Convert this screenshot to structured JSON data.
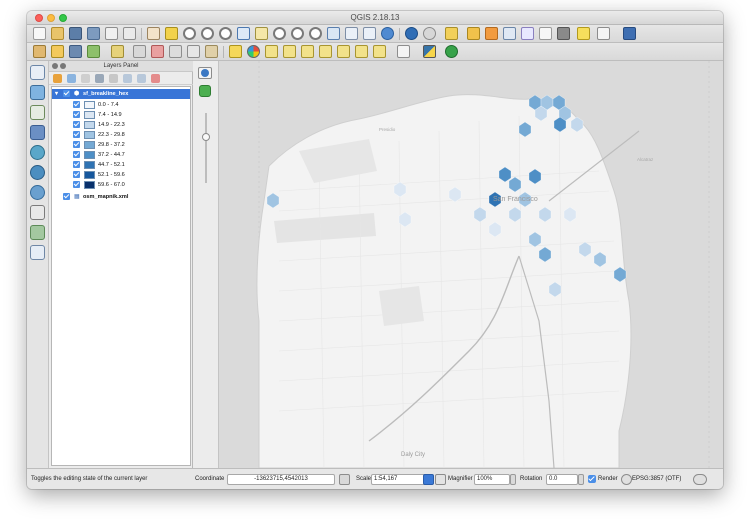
{
  "window": {
    "title": "QGIS 2.18.13"
  },
  "layers_panel": {
    "title": "Layers Panel",
    "layers": [
      {
        "name": "sf_breakline_hex",
        "checked": true,
        "selected": true,
        "legend": [
          {
            "label": "0.0 - 7.4",
            "color": "#f2f6fb"
          },
          {
            "label": "7.4 - 14.9",
            "color": "#dce7f3"
          },
          {
            "label": "14.9 - 22.3",
            "color": "#c3d8ec"
          },
          {
            "label": "22.3 - 29.8",
            "color": "#a0c4e2"
          },
          {
            "label": "29.8 - 37.2",
            "color": "#74a9d4"
          },
          {
            "label": "37.2 - 44.7",
            "color": "#4e8fc6"
          },
          {
            "label": "44.7 - 52.1",
            "color": "#2f73b3"
          },
          {
            "label": "52.1 - 59.6",
            "color": "#16579d"
          },
          {
            "label": "59.6 - 67.0",
            "color": "#08306b"
          }
        ]
      },
      {
        "name": "osm_mapnik.xml",
        "checked": true,
        "selected": false
      }
    ]
  },
  "map": {
    "labels": {
      "city": "San Francisco",
      "daly_city": "Daly City",
      "alcatraz": "Alcatraz",
      "presidio": "Presidio"
    }
  },
  "status_bar": {
    "message": "Toggles the editing state of the current layer",
    "coordinate_label": "Coordinate",
    "coordinate_value": "-13623715,4542013",
    "scale_label": "Scale",
    "scale_value": "1:54,167",
    "magnifier_label": "Magnifier",
    "magnifier_value": "100%",
    "rotation_label": "Rotation",
    "rotation_value": "0.0",
    "render_label": "Render",
    "render_checked": true,
    "crs_label": "EPSG:3857 (OTF)"
  },
  "icons": {
    "toolbar1": [
      "new-project-icon",
      "open-project-icon",
      "save-project-icon",
      "save-as-icon",
      "new-print-composer-icon",
      "composer-manager-icon",
      "pan-icon",
      "pan-to-selection-icon",
      "zoom-in-icon",
      "zoom-out-icon",
      "zoom-native-icon",
      "zoom-full-icon",
      "zoom-to-selection-icon",
      "zoom-to-layer-icon",
      "zoom-last-icon",
      "zoom-next-icon",
      "new-map-view-icon",
      "bookmark-icon",
      "show-bookmarks-icon",
      "refresh-icon",
      "identify-icon",
      "select-icon",
      "measure-icon",
      "open-attribute-table-icon",
      "statistics-icon",
      "field-calculator-icon",
      "sum-icon",
      "map-tips-icon",
      "comment-icon",
      "text-annotation-icon",
      "help-icon"
    ],
    "toolbar2": [
      "edit-pencil-icon",
      "toggle-editing-icon",
      "save-edits-icon",
      "add-feature-icon",
      "move-feature-icon",
      "node-tool-icon",
      "delete-selected-icon",
      "cut-features-icon",
      "copy-features-icon",
      "paste-features-icon",
      "label-tool-icon",
      "layer-labeling-icon",
      "pin-labels-icon",
      "show-hide-labels-icon",
      "move-label-icon",
      "rotate-label-icon",
      "change-label-icon",
      "csw-icon",
      "python-console-icon",
      "plugin-icon"
    ]
  }
}
